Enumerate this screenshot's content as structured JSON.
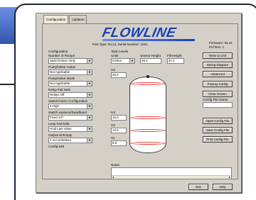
{
  "tabs": [
    {
      "label": "Configuration",
      "active": true
    },
    {
      "label": "Updates",
      "active": false
    }
  ],
  "header": {
    "logo": "FLOWLINE",
    "part_type": "Part Type: DL14, Serial Number: 1001",
    "firmware": "Firmware: DL14",
    "pcb_rev": "Pcf Rev: 1"
  },
  "configuration": {
    "heading": "Configuration",
    "fields": [
      {
        "label": "Number of Pumps",
        "value": "Switch/Alarm Only"
      },
      {
        "label": "Pump/Valve Action",
        "value": "Not Applicable"
      },
      {
        "label": "Pump/Valve Mode",
        "value": "Not Applicable"
      },
      {
        "label": "Relay Fail Safe",
        "value": "Relays Off"
      },
      {
        "label": "Switch/Alarm Configuration",
        "value": "4-High"
      },
      {
        "label": "Switch Hysteris/Deadband",
        "value": "Fixed 1/2\""
      },
      {
        "label": "Loop Fail Safe",
        "value": "Hold Last Value"
      },
      {
        "label": "Output at Empty",
        "value": "4 mA at Bottom"
      }
    ],
    "config_id": "Config 840"
  },
  "tank_levels": {
    "heading": "Tank Levels",
    "units_label": "Units",
    "units_value": "Inches",
    "sensor_height_label": "Sensor Height",
    "sensor_height_value": "49.2",
    "fill_height_label": "Fill Height",
    "fill_height_value": "47.2",
    "levels": [
      {
        "label": "H4",
        "value": "25.0"
      },
      {
        "label": "H3",
        "value": "16.0"
      },
      {
        "label": "H2",
        "value": "12.0"
      },
      {
        "label": "H1",
        "value": "8.0"
      }
    ]
  },
  "buttons": {
    "write_to_unit": "Write to Unit",
    "wiring_diagram": "Wiring Diagram",
    "advanced": "Advanced",
    "factory_config": "Factory Config",
    "clear_screen": "Clear Screen",
    "config_file_name": "Config File Name",
    "open_config_file": "Open Config File",
    "save_config_file": "Save Config File",
    "print_config_file": "Print Config File",
    "exit": "Exit",
    "help": "Help"
  },
  "notes": {
    "label": "Notes"
  }
}
